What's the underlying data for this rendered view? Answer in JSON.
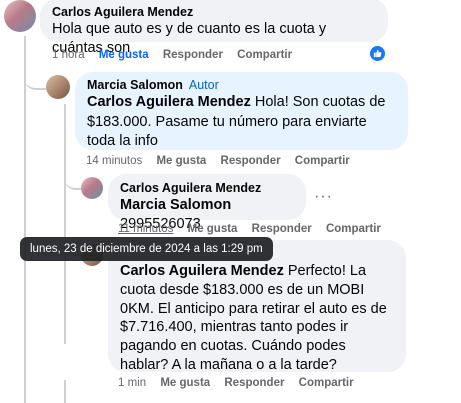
{
  "comments": [
    {
      "author": "Carlos Aguilera Mendez",
      "text": "Hola que auto es y de cuanto es la cuota y cuántas son",
      "time": "1 hora",
      "like": "Me gusta",
      "reply": "Responder",
      "share": "Compartir",
      "liked": true
    },
    {
      "author": "Marcia Salomon",
      "author_tag": "Autor",
      "mention": "Carlos Aguilera Mendez",
      "text": " Hola! Son cuotas de $183.000. Pasame tu número para enviarte toda la info",
      "time": "14 minutos",
      "like": "Me gusta",
      "reply": "Responder",
      "share": "Compartir"
    },
    {
      "author": "Carlos Aguilera Mendez",
      "mention": "Marcia Salomon",
      "text": " 2995526073",
      "time": "11 minutos",
      "like": "Me gusta",
      "reply": "Responder",
      "share": "Compartir",
      "more": "···"
    },
    {
      "mention": "Carlos Aguilera Mendez",
      "text": " Perfecto! La cuota desde $183.000 es de un MOBI 0KM. El anticipo para retirar el auto es de $7.716.400, mientras tanto podes ir pagando en cuotas. Cuándo podes hablar? A la mañana o a la tarde?",
      "time": "1 min",
      "like": "Me gusta",
      "reply": "Responder",
      "share": "Compartir"
    }
  ],
  "tooltip": "lunes, 23 de diciembre de 2024 a las 1:29 pm",
  "colors": {
    "link_blue": "#0866ff",
    "author_blue": "#0064d1",
    "bubble_gray": "#f0f2f5",
    "bubble_blue": "#e7f3ff"
  }
}
